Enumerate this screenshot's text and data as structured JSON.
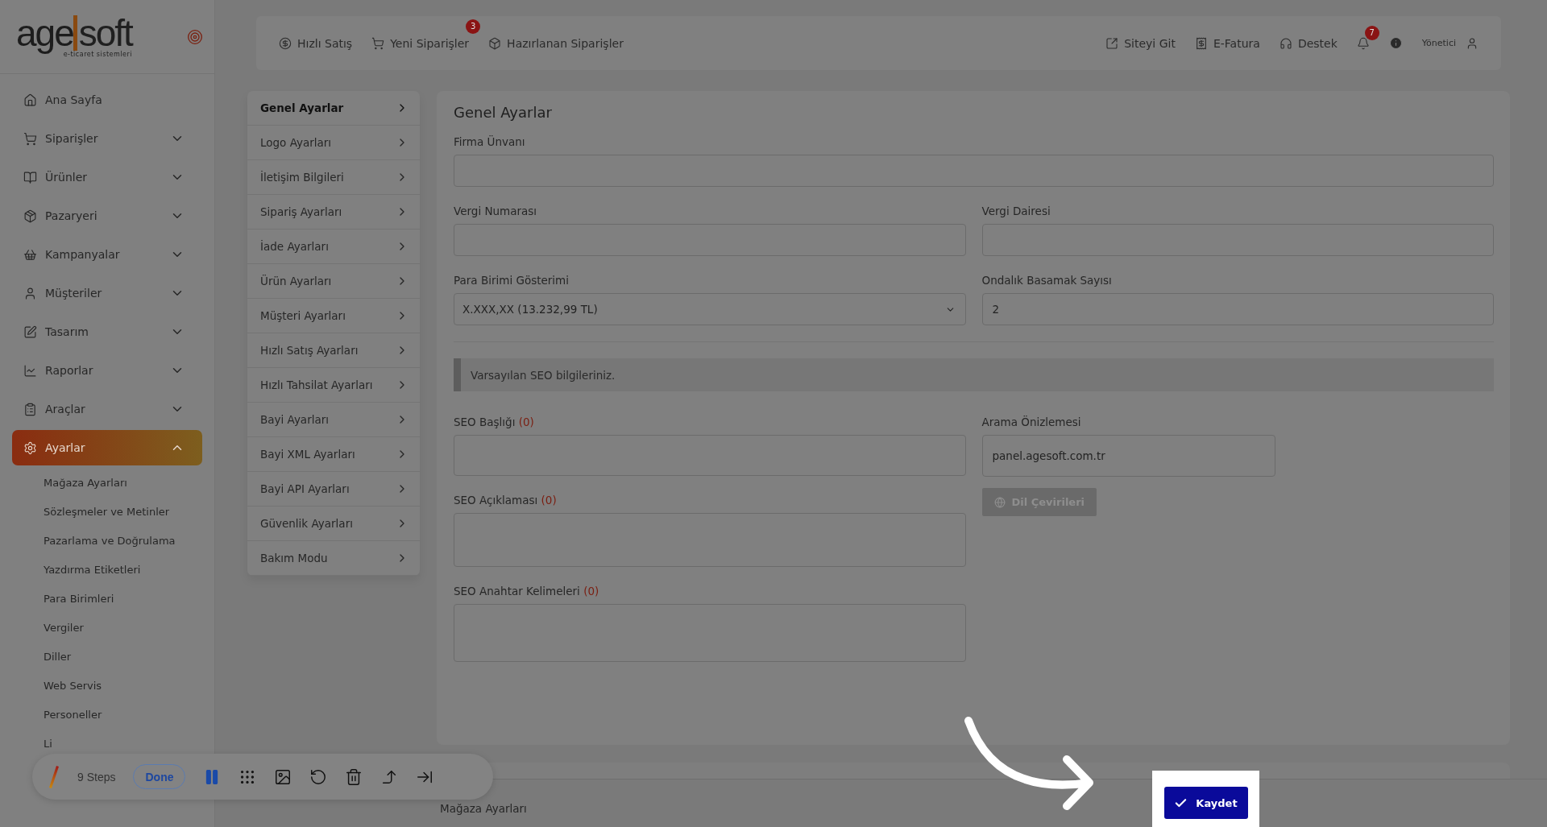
{
  "logo": {
    "main": "age",
    "accent": "soft",
    "tagline": "e-ticaret sistemleri"
  },
  "sidebar": {
    "items": [
      {
        "label": "Ana Sayfa",
        "kind": "link",
        "selected": false
      },
      {
        "label": "Siparişler",
        "kind": "group",
        "selected": false,
        "expanded": false
      },
      {
        "label": "Ürünler",
        "kind": "group",
        "selected": false,
        "expanded": false
      },
      {
        "label": "Pazaryeri",
        "kind": "group",
        "selected": false,
        "expanded": false
      },
      {
        "label": "Kampanyalar",
        "kind": "group",
        "selected": false,
        "expanded": false
      },
      {
        "label": "Müşteriler",
        "kind": "group",
        "selected": false,
        "expanded": false
      },
      {
        "label": "Tasarım",
        "kind": "group",
        "selected": false,
        "expanded": false
      },
      {
        "label": "Raporlar",
        "kind": "group",
        "selected": false,
        "expanded": false
      },
      {
        "label": "Araçlar",
        "kind": "group",
        "selected": false,
        "expanded": false
      },
      {
        "label": "Ayarlar",
        "kind": "group",
        "selected": true,
        "expanded": true,
        "children": [
          "Mağaza Ayarları",
          "Sözleşmeler ve Metinler",
          "Pazarlama ve Doğrulama",
          "Yazdırma Etiketleri",
          "Para Birimleri",
          "Vergiler",
          "Diller",
          "Web Servis",
          "Personeller",
          "Li"
        ]
      }
    ]
  },
  "topbar": {
    "left": [
      {
        "label": "Hızlı Satış"
      },
      {
        "label": "Yeni Siparişler",
        "badge": "3"
      },
      {
        "label": "Hazırlanan Siparişler"
      }
    ],
    "right": [
      {
        "label": "Siteyi Git"
      },
      {
        "label": "E-Fatura"
      },
      {
        "label": "Destek"
      }
    ],
    "notifications": {
      "badge": "7"
    },
    "user": "Yönetici"
  },
  "settings_menu": [
    {
      "label": "Genel Ayarlar",
      "selected": true
    },
    {
      "label": "Logo Ayarları",
      "selected": false
    },
    {
      "label": "İletişim Bilgileri",
      "selected": false
    },
    {
      "label": "Sipariş Ayarları",
      "selected": false
    },
    {
      "label": "İade Ayarları",
      "selected": false
    },
    {
      "label": "Ürün Ayarları",
      "selected": false
    },
    {
      "label": "Müşteri Ayarları",
      "selected": false
    },
    {
      "label": "Hızlı Satış Ayarları",
      "selected": false
    },
    {
      "label": "Hızlı Tahsilat Ayarları",
      "selected": false
    },
    {
      "label": "Bayi Ayarları",
      "selected": false
    },
    {
      "label": "Bayi XML Ayarları",
      "selected": false
    },
    {
      "label": "Bayi API Ayarları",
      "selected": false
    },
    {
      "label": "Güvenlik Ayarları",
      "selected": false
    },
    {
      "label": "Bakım Modu",
      "selected": false
    }
  ],
  "form": {
    "title": "Genel Ayarlar",
    "company": {
      "label": "Firma Ünvanı"
    },
    "tax_number": {
      "label": "Vergi Numarası"
    },
    "tax_office": {
      "label": "Vergi Dairesi"
    },
    "currency_display": {
      "label": "Para Birimi Gösterimi",
      "value": "X.XXX,XX (13.232,99 TL)"
    },
    "decimals": {
      "label": "Ondalık Basamak Sayısı",
      "value": "2"
    },
    "seo_notice": "Varsayılan SEO bilgileriniz.",
    "seo_title": {
      "label": "SEO Başlığı",
      "count": "(0)"
    },
    "seo_description": {
      "label": "SEO Açıklaması",
      "count": "(0)"
    },
    "seo_keywords": {
      "label": "SEO Anahtar Kelimeleri",
      "count": "(0)"
    },
    "search_preview": {
      "label": "Arama Önizlemesi",
      "value": "panel.agesoft.com.tr"
    },
    "translations_button": {
      "label": "Dil Çevirileri",
      "disabled": true
    }
  },
  "footer": {
    "breadcrumb": "Mağaza Ayarları",
    "save_button": "Kaydet"
  },
  "recorder": {
    "steps": "9 Steps",
    "done": "Done"
  }
}
